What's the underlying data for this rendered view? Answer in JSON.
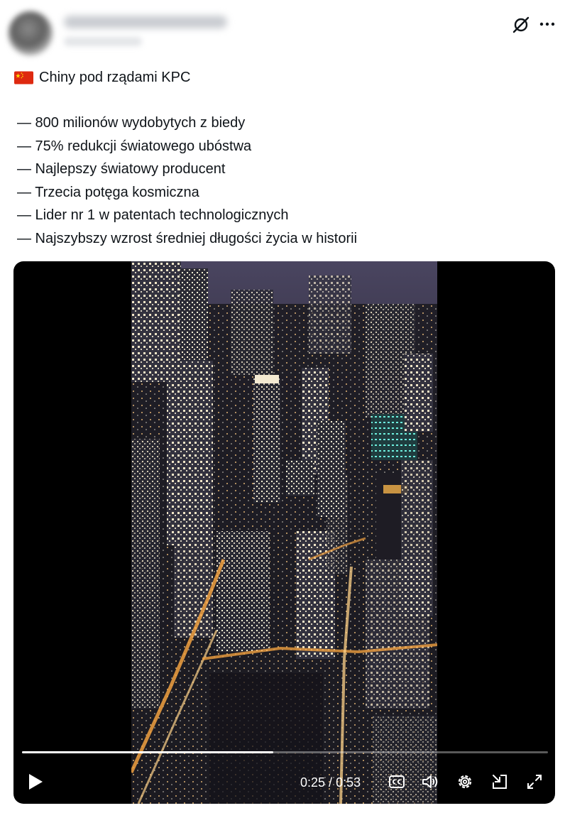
{
  "post": {
    "title": "Chiny pod rządami KPC",
    "flag_icon": "china-flag-icon",
    "bullets": [
      "— 800 milionów wydobytych z biedy",
      "— 75% redukcji światowego ubóstwa",
      "— Najlepszy światowy producent",
      "— Trzecia potęga kosmiczna",
      "— Lider nr 1 w patentach technologicznych",
      "— Najszybszy wzrost średniej długości życia w historii"
    ]
  },
  "header": {
    "grok_icon": "grok-icon",
    "more_icon": "more-icon"
  },
  "video": {
    "current_time": "0:25",
    "separator": " / ",
    "duration": "0:53",
    "progress_fraction": 0.478,
    "controls": [
      "play-icon",
      "captions-icon",
      "volume-icon",
      "settings-icon",
      "picture-in-picture-icon",
      "fullscreen-icon"
    ]
  },
  "colors": {
    "text": "#0f1419",
    "video_bg": "#000000",
    "flag_red": "#de2910",
    "flag_yellow": "#ffde00"
  }
}
